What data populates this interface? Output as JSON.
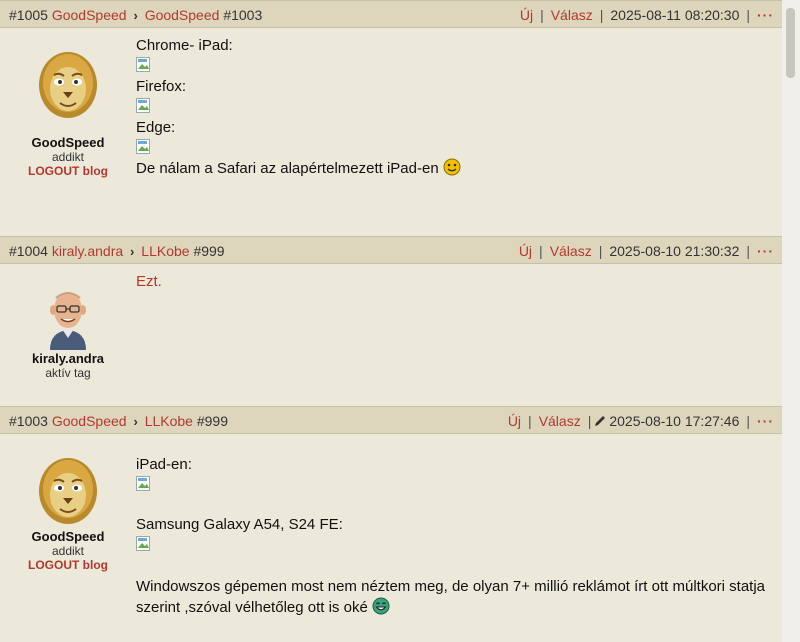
{
  "posts": [
    {
      "id": "#1005",
      "author": "GoodSpeed",
      "reply_to_user": "GoodSpeed",
      "reply_to_id": "#1003",
      "new_label": "Új",
      "reply_label": "Válasz",
      "timestamp": "2025-08-11 08:20:30",
      "more": "···",
      "username": "GoodSpeed",
      "rank": "addikt",
      "blog": "LOGOUT blog",
      "lines": [
        "Chrome- iPad:",
        "Firefox:",
        "Edge:",
        "De nálam a Safari az alapértelmezett iPad-en"
      ]
    },
    {
      "id": "#1004",
      "author": "kiraly.andra",
      "reply_to_user": "LLKobe",
      "reply_to_id": "#999",
      "new_label": "Új",
      "reply_label": "Válasz",
      "timestamp": "2025-08-10 21:30:32",
      "more": "···",
      "username": "kiraly.andra",
      "rank": "aktív tag",
      "lines": [
        "Ezt."
      ]
    },
    {
      "id": "#1003",
      "author": "GoodSpeed",
      "reply_to_user": "LLKobe",
      "reply_to_id": "#999",
      "new_label": "Új",
      "reply_label": "Válasz",
      "timestamp": "2025-08-10 17:27:46",
      "more": "···",
      "username": "GoodSpeed",
      "rank": "addikt",
      "blog": "LOGOUT blog",
      "lines": [
        "iPad-en:",
        "Samsung Galaxy A54, S24 FE:",
        "Windowszos gépemen most nem néztem meg, de olyan 7+ millió reklámot írt ott múltkori statja szerint ,szóval vélhetőleg ott is oké"
      ]
    }
  ],
  "colors": {
    "link": "#b2392f",
    "header_bg": "#ddd6bd",
    "body_bg": "#ece8da"
  },
  "icons": [
    "lion-avatar",
    "man-avatar",
    "smiley-icon",
    "laughing-smiley-icon",
    "pencil-edit-icon",
    "broken-image-icon"
  ]
}
